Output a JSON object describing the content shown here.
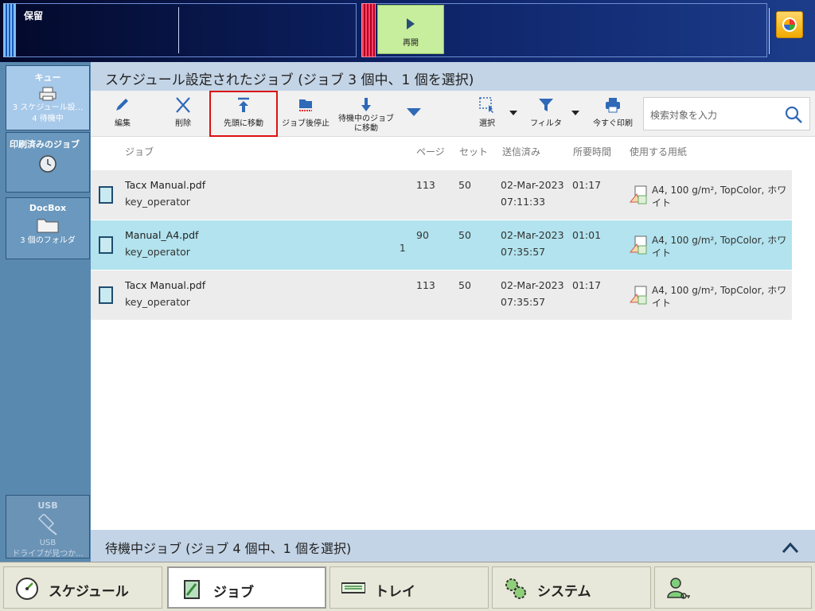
{
  "topbar": {
    "hold_label": "保留",
    "resume_label": "再開"
  },
  "leftnav": {
    "queue": {
      "title": "キュー",
      "line1": "3 スケジュール設...",
      "line2": "4 待機中"
    },
    "printed": {
      "title": "印刷済みのジョブ"
    },
    "docbox": {
      "title": "DocBox",
      "sub": "3 個のフォルダ"
    },
    "usb": {
      "title": "USB",
      "line1": "USB",
      "line2": "ドライブが見つか..."
    }
  },
  "main": {
    "heading": "スケジュール設定されたジョブ (ジョブ 3 個中、1 個を選択)",
    "toolbar": {
      "edit": "編集",
      "delete": "削除",
      "move_to_top": "先頭に移動",
      "stop_after_job": "ジョブ後停止",
      "move_waiting_1": "待機中のジョブ",
      "move_waiting_2": "に移動",
      "select": "選択",
      "filter": "フィルタ",
      "print_now": "今すぐ印刷",
      "search_placeholder": "検索対象を入力"
    },
    "columns": {
      "job": "ジョブ",
      "pages": "ページ",
      "sets": "セット",
      "sent": "送信済み",
      "duration": "所要時間",
      "paper": "使用する用紙"
    },
    "rows": [
      {
        "name": "Tacx Manual.pdf",
        "owner": "key_operator",
        "pages": "113",
        "sets": "50",
        "date": "02-Mar-2023",
        "time": "07:11:33",
        "duration": "01:17",
        "paper": "A4, 100 g/m², TopColor, ホワイト",
        "badge": ""
      },
      {
        "name": "Manual_A4.pdf",
        "owner": "key_operator",
        "pages": "90",
        "sets": "50",
        "date": "02-Mar-2023",
        "time": "07:35:57",
        "duration": "01:01",
        "paper": "A4, 100 g/m², TopColor, ホワイト",
        "badge": "1"
      },
      {
        "name": "Tacx Manual.pdf",
        "owner": "key_operator",
        "pages": "113",
        "sets": "50",
        "date": "02-Mar-2023",
        "time": "07:35:57",
        "duration": "01:17",
        "paper": "A4, 100 g/m², TopColor, ホワイト",
        "badge": ""
      }
    ],
    "waiting_heading": "待機中ジョブ (ジョブ 4 個中、1 個を選択)"
  },
  "bottom": {
    "schedule": "スケジュール",
    "jobs": "ジョブ",
    "tray": "トレイ",
    "system": "システム"
  }
}
